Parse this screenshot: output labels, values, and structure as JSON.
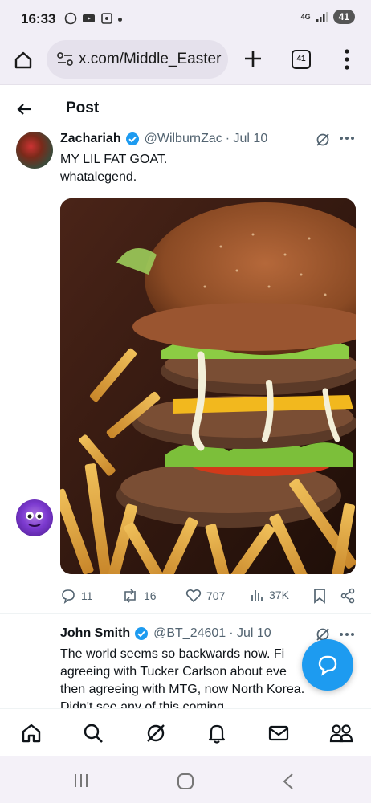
{
  "status_bar": {
    "time": "16:33",
    "network": "4G",
    "battery": "41"
  },
  "browser": {
    "url": "x.com/Middle_Easter",
    "tab_count": "41"
  },
  "header": {
    "title": "Post"
  },
  "tweet": {
    "author_name": "Zachariah",
    "handle": "@WilburnZac",
    "date": "· Jul 10",
    "text_line1": "MY LIL FAT GOAT.",
    "text_line2": "whatalegend.",
    "stats": {
      "replies": "11",
      "reposts": "16",
      "likes": "707",
      "views": "37K"
    }
  },
  "reply": {
    "author_name": "John Smith",
    "handle": "@BT_24601",
    "date": "· Jul 10",
    "line1": "The world seems so backwards now.  Fi",
    "line2": "agreeing with Tucker Carlson about eve",
    "line3": "then agreeing with MTG, now North Korea.",
    "line4": "Didn't see any of this coming"
  },
  "colors": {
    "accent": "#1d9bf0",
    "text_primary": "#0f1419",
    "text_secondary": "#536471",
    "browser_chrome": "#f1eef6"
  },
  "icons": {
    "home": "home-icon",
    "search": "search-icon",
    "grok": "grok-icon",
    "notifications": "bell-icon",
    "messages": "mail-icon",
    "communities": "people-icon"
  }
}
